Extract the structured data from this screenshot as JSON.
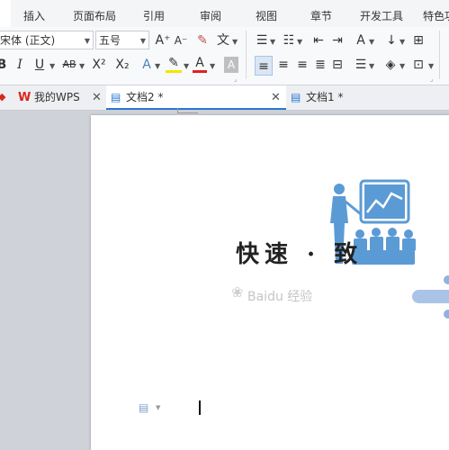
{
  "menu": [
    "插入",
    "页面布局",
    "引用",
    "审阅",
    "视图",
    "章节",
    "开发工具",
    "特色功"
  ],
  "toolbar": {
    "font_name": "宋体 (正文)",
    "font_size": "五号",
    "grow_font": "A⁺",
    "shrink_font": "A⁻",
    "bold": "B",
    "italic": "I",
    "underline": "U",
    "strikethrough": "AB",
    "superscript": "X²",
    "subscript": "X₂",
    "text_effect": "A",
    "font_color": "A",
    "char_shading": "A"
  },
  "tabs": [
    {
      "label": "我的WPS"
    },
    {
      "label": "文档2 *",
      "active": true
    },
    {
      "label": "文档1 *"
    }
  ],
  "document": {
    "title_text": "快速 · 致",
    "watermark": "Baidu 经验"
  },
  "colors": {
    "accent": "#2b78d4",
    "icon_blue": "#5b9bd5",
    "wps_red": "#d9261c"
  }
}
